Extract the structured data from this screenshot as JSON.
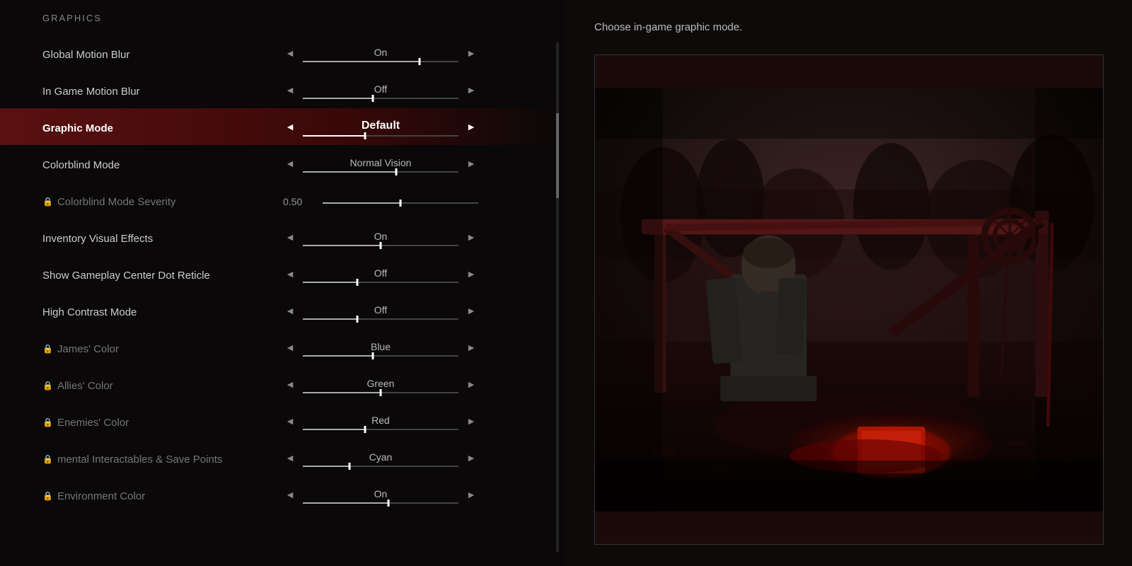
{
  "section": {
    "title": "GRAPHICS"
  },
  "description": "Choose in-game graphic mode.",
  "settings": [
    {
      "id": "global-motion-blur",
      "label": "Global Motion Blur",
      "value": "On",
      "sliderPos": 75,
      "locked": false,
      "active": false,
      "hasSeverity": false,
      "severityValue": null
    },
    {
      "id": "in-game-motion-blur",
      "label": "In Game Motion Blur",
      "value": "Off",
      "sliderPos": 45,
      "locked": false,
      "active": false,
      "hasSeverity": false,
      "severityValue": null
    },
    {
      "id": "graphic-mode",
      "label": "Graphic Mode",
      "value": "Default",
      "sliderPos": 40,
      "locked": false,
      "active": true,
      "hasSeverity": false,
      "severityValue": null
    },
    {
      "id": "colorblind-mode",
      "label": "Colorblind Mode",
      "value": "Normal Vision",
      "sliderPos": 60,
      "locked": false,
      "active": false,
      "hasSeverity": false,
      "severityValue": null
    },
    {
      "id": "colorblind-severity",
      "label": "Colorblind Mode Severity",
      "value": "",
      "sliderPos": 50,
      "locked": true,
      "active": false,
      "hasSeverity": true,
      "severityValue": "0.50"
    },
    {
      "id": "inventory-visual-effects",
      "label": "Inventory Visual Effects",
      "value": "On",
      "sliderPos": 50,
      "locked": false,
      "active": false,
      "hasSeverity": false,
      "severityValue": null
    },
    {
      "id": "gameplay-center-dot",
      "label": "Show Gameplay Center Dot Reticle",
      "value": "Off",
      "sliderPos": 35,
      "locked": false,
      "active": false,
      "hasSeverity": false,
      "severityValue": null
    },
    {
      "id": "high-contrast-mode",
      "label": "High Contrast Mode",
      "value": "Off",
      "sliderPos": 35,
      "locked": false,
      "active": false,
      "hasSeverity": false,
      "severityValue": null
    },
    {
      "id": "james-color",
      "label": "James' Color",
      "value": "Blue",
      "sliderPos": 45,
      "locked": true,
      "active": false,
      "hasSeverity": false,
      "severityValue": null
    },
    {
      "id": "allies-color",
      "label": "Allies' Color",
      "value": "Green",
      "sliderPos": 50,
      "locked": true,
      "active": false,
      "hasSeverity": false,
      "severityValue": null
    },
    {
      "id": "enemies-color",
      "label": "Enemies' Color",
      "value": "Red",
      "sliderPos": 40,
      "locked": true,
      "active": false,
      "hasSeverity": false,
      "severityValue": null
    },
    {
      "id": "mental-interactables",
      "label": "mental Interactables & Save Points",
      "value": "Cyan",
      "sliderPos": 30,
      "locked": true,
      "active": false,
      "hasSeverity": false,
      "severityValue": null
    },
    {
      "id": "environment-color",
      "label": "Environment Color",
      "value": "On",
      "sliderPos": 55,
      "locked": true,
      "active": false,
      "hasSeverity": false,
      "severityValue": null
    }
  ],
  "icons": {
    "arrow_left": "◄",
    "arrow_right": "►",
    "lock": "🔒"
  }
}
